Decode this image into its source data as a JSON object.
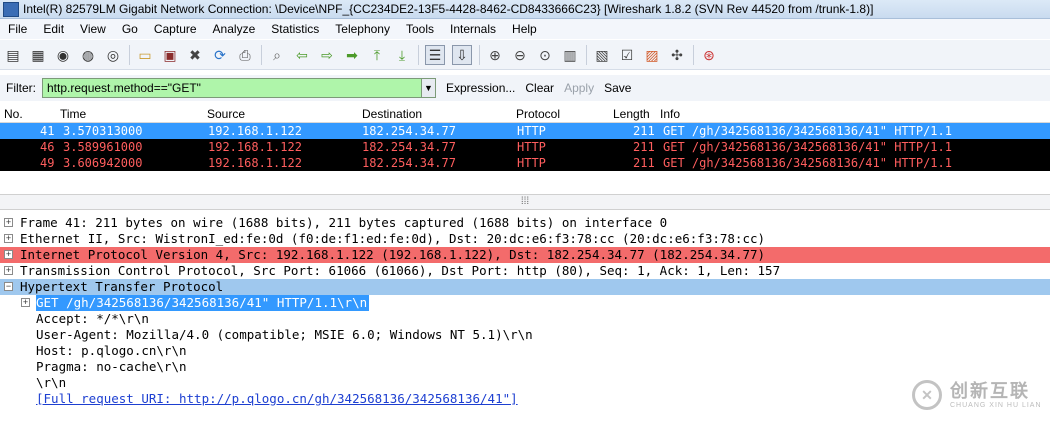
{
  "window": {
    "title": "Intel(R) 82579LM Gigabit Network Connection: \\Device\\NPF_{CC234DE2-13F5-4428-8462-CD8433666C23}   [Wireshark 1.8.2  (SVN Rev 44520 from /trunk-1.8)]"
  },
  "menu": [
    "File",
    "Edit",
    "View",
    "Go",
    "Capture",
    "Analyze",
    "Statistics",
    "Telephony",
    "Tools",
    "Internals",
    "Help"
  ],
  "filter": {
    "label": "Filter:",
    "value": "http.request.method==\"GET\"",
    "expression": "Expression...",
    "clear": "Clear",
    "apply": "Apply",
    "save": "Save"
  },
  "packet_list": {
    "columns": [
      "No.",
      "Time",
      "Source",
      "Destination",
      "Protocol",
      "Length",
      "Info"
    ],
    "rows": [
      {
        "no": "41",
        "time": "3.570313000",
        "source": "192.168.1.122",
        "destination": "182.254.34.77",
        "protocol": "HTTP",
        "length": "211",
        "info": "GET /gh/342568136/342568136/41\" HTTP/1.1"
      },
      {
        "no": "46",
        "time": "3.589961000",
        "source": "192.168.1.122",
        "destination": "182.254.34.77",
        "protocol": "HTTP",
        "length": "211",
        "info": "GET /gh/342568136/342568136/41\" HTTP/1.1"
      },
      {
        "no": "49",
        "time": "3.606942000",
        "source": "192.168.1.122",
        "destination": "182.254.34.77",
        "protocol": "HTTP",
        "length": "211",
        "info": "GET /gh/342568136/342568136/41\" HTTP/1.1"
      }
    ]
  },
  "details": {
    "frame": "Frame 41: 211 bytes on wire (1688 bits), 211 bytes captured (1688 bits) on interface 0",
    "ethernet": "Ethernet II, Src: WistronI_ed:fe:0d (f0:de:f1:ed:fe:0d), Dst: 20:dc:e6:f3:78:cc (20:dc:e6:f3:78:cc)",
    "ip": "Internet Protocol Version 4, Src: 192.168.1.122 (192.168.1.122), Dst: 182.254.34.77 (182.254.34.77)",
    "tcp": "Transmission Control Protocol, Src Port: 61066 (61066), Dst Port: http (80), Seq: 1, Ack: 1, Len: 157",
    "http": "Hypertext Transfer Protocol",
    "request_line": "GET /gh/342568136/342568136/41\" HTTP/1.1\\r\\n",
    "accept": "Accept: */*\\r\\n",
    "user_agent": "User-Agent: Mozilla/4.0 (compatible; MSIE 6.0; Windows NT 5.1)\\r\\n",
    "host": "Host: p.qlogo.cn\\r\\n",
    "pragma": "Pragma: no-cache\\r\\n",
    "crlf": "\\r\\n",
    "full_uri": "[Full request URI: http://p.qlogo.cn/gh/342568136/342568136/41\"]"
  },
  "watermark": {
    "main": "创新互联",
    "sub": "CHUANG XIN HU LIAN"
  },
  "colors": {
    "selected": "#3399ff",
    "filter_ok": "#aff5aa",
    "ip_row": "#f36b6b",
    "http_row": "#9fc8ee",
    "black_row_text": "#ff5e5e"
  }
}
